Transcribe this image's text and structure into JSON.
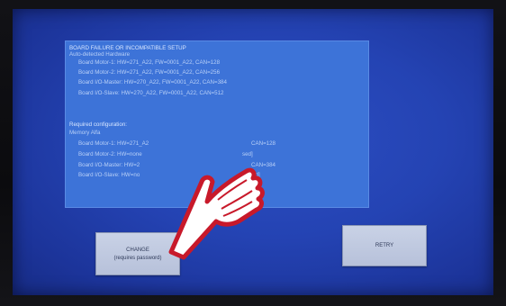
{
  "error_panel": {
    "lines": [
      "BOARD FAILURE OR INCOMPATIBLE SETUP",
      "Auto-detected Hardware",
      "Board Motor-1: HW=271_A22, FW=0001_A22, CAN=128",
      "Board Motor-2: HW=271_A22, FW=0001_A22, CAN=256",
      "Board I/O-Master: HW=270_A22, FW=0001_A22, CAN=384",
      "Board I/O-Slave: HW=270_A22, FW=0001_A22, CAN=512",
      "Required configuration:",
      "Memory Alfa",
      "Board Motor-1: HW=271_A2",
      "Board Motor-2: HW=none",
      "Board I/O-Master: HW=2",
      "Board I/O-Slave: HW=no",
      "CAN=128",
      "sed]",
      "CAN=384",
      "sed]"
    ]
  },
  "buttons": {
    "change_label": "CHANGE",
    "change_sub": "(requires password)",
    "retry_label": "RETRY"
  },
  "colors": {
    "screen_blue": "#2443b3",
    "panel_blue": "#3d73d8",
    "button_gray": "#c0c9df",
    "hand_red": "#c8192a"
  },
  "overlay": {
    "icon": "pointing-hand-icon"
  }
}
